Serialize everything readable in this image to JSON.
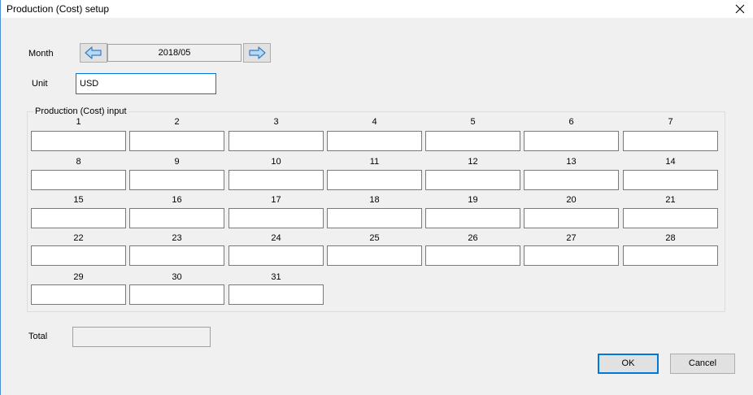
{
  "window": {
    "title": "Production (Cost) setup"
  },
  "month": {
    "label": "Month",
    "value": "2018/05"
  },
  "unit": {
    "label": "Unit",
    "value": "USD"
  },
  "group": {
    "label": "Production (Cost) input"
  },
  "days": [
    "1",
    "2",
    "3",
    "4",
    "5",
    "6",
    "7",
    "8",
    "9",
    "10",
    "11",
    "12",
    "13",
    "14",
    "15",
    "16",
    "17",
    "18",
    "19",
    "20",
    "21",
    "22",
    "23",
    "24",
    "25",
    "26",
    "27",
    "28",
    "29",
    "30",
    "31"
  ],
  "total": {
    "label": "Total",
    "value": ""
  },
  "buttons": {
    "ok": "OK",
    "cancel": "Cancel"
  },
  "icons": {
    "prev": "left-arrow-icon",
    "next": "right-arrow-icon",
    "close": "close-icon"
  },
  "colors": {
    "accent": "#0078d7",
    "arrow_fill": "#b3d9f5",
    "arrow_stroke": "#3a7cc6"
  }
}
